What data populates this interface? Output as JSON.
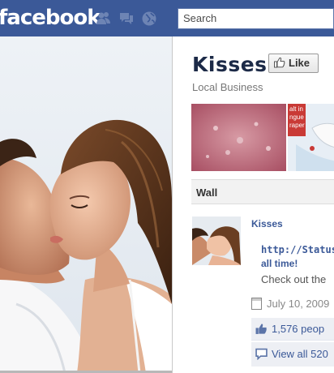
{
  "topbar": {
    "brand": "facebook",
    "search_placeholder": "Search",
    "jewels": [
      "friend-requests-icon",
      "messages-icon",
      "notifications-icon"
    ]
  },
  "page": {
    "name": "Kisses",
    "category": "Local Business",
    "like_label": "Like"
  },
  "wall": {
    "heading": "Wall",
    "post": {
      "author": "Kisses",
      "link_line1": "http://StatusS",
      "link_line2": "all time!",
      "text": "Check out the",
      "date": "July 10, 2009",
      "likes": "1,576 peop",
      "comments": "View all 520"
    }
  },
  "colors": {
    "brand_blue": "#3b5998",
    "link_blue": "#3b5998",
    "title_navy": "#1c2a47"
  }
}
